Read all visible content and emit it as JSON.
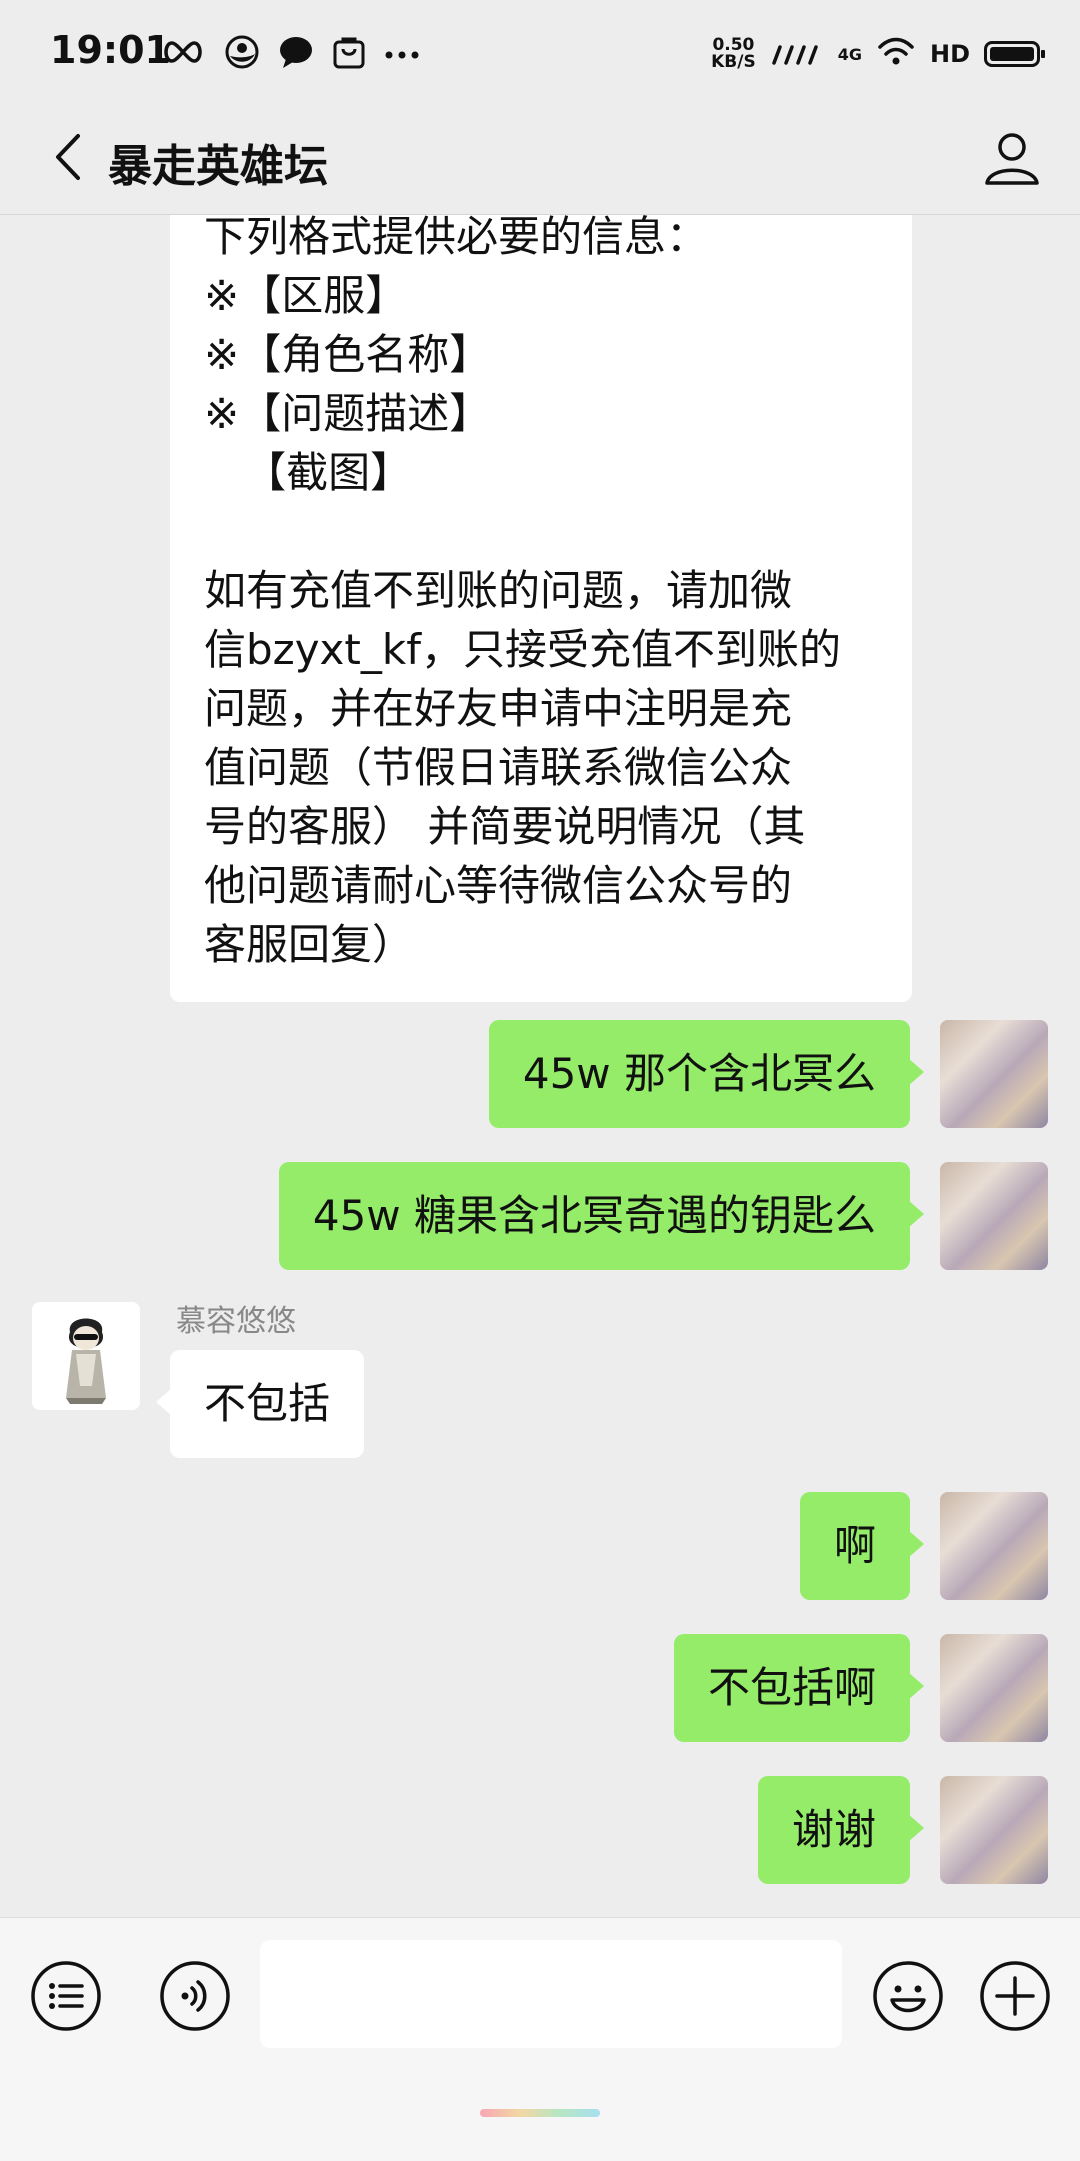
{
  "status_bar": {
    "time": "19:01",
    "net_speed_value": "0.50",
    "net_speed_unit": "KB/S",
    "signal_label": "4G",
    "hd_label": "HD",
    "left_icons": [
      "infinity-icon",
      "yin-yang-icon",
      "chat-bubble-icon",
      "shopping-bag-icon",
      "more-dots-icon"
    ],
    "right_icons": [
      "signal-icon",
      "wifi-icon",
      "hd-icon",
      "battery-icon"
    ]
  },
  "header": {
    "title": "暴走英雄坛",
    "back_icon": "chevron-left-icon",
    "profile_icon": "person-icon"
  },
  "long_message": {
    "lines_top": [
      "下列格式提供必要的信息：",
      "※【区服】",
      "※【角色名称】",
      "※【问题描述】",
      "   【截图】"
    ],
    "paragraph_lines": [
      "如有充值不到账的问题，请加微",
      "信bzyxt_kf，只接受充值不到账的",
      "问题，并在好友申请中注明是充",
      "值问题（节假日请联系微信公众",
      "号的客服） 并简要说明情况（其",
      "他问题请耐心等待微信公众号的",
      "客服回复）"
    ]
  },
  "messages": [
    {
      "from": "me",
      "text": "45w 那个含北冥么"
    },
    {
      "from": "me",
      "text": "45w 糖果含北冥奇遇的钥匙么"
    },
    {
      "from": "other",
      "sender": "慕容悠悠",
      "text": "不包括"
    },
    {
      "from": "me",
      "text": "啊"
    },
    {
      "from": "me",
      "text": "不包括啊"
    },
    {
      "from": "me",
      "text": "谢谢"
    }
  ],
  "input_bar": {
    "text_value": "",
    "icons": [
      "menu-list-icon",
      "voice-icon",
      "emoji-icon",
      "plus-icon"
    ]
  },
  "colors": {
    "background": "#ededed",
    "my_bubble": "#95ec69",
    "other_bubble": "#ffffff",
    "input_bar": "#f6f6f6"
  }
}
